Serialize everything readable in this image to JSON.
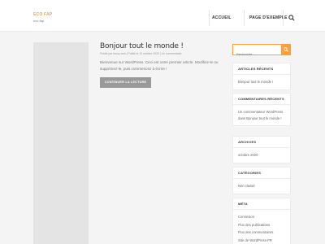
{
  "site": {
    "title": "ECO FAP",
    "tagline": "eco fap"
  },
  "nav": {
    "items": [
      "ACCUEIL",
      "PAGE D'EXEMPLE"
    ]
  },
  "post": {
    "title": "Bonjour tout le monde !",
    "meta": "Publié par lecoq-web | Publié le 13 octobre 2020 | Un commentaire",
    "excerpt": "Bienvenue sur WordPress. Ceci est votre premier article. Modifiez-le ou supprimez-le, puis commencez à écrire !",
    "read_more": "CONTINUER LA LECTURE"
  },
  "search": {
    "placeholder": "Recherche..."
  },
  "widgets": {
    "recent_posts": {
      "title": "ARTICLES RÉCENTS",
      "items": [
        "Bonjour tout le monde !"
      ]
    },
    "recent_comments": {
      "title": "COMMENTAIRES RÉCENTS",
      "items": [
        "Un commentateur WordPress dans Bonjour tout le monde !"
      ]
    },
    "archives": {
      "title": "ARCHIVES",
      "items": [
        "octobre 2020"
      ]
    },
    "categories": {
      "title": "CATÉGORIES",
      "items": [
        "Non classé"
      ]
    },
    "meta": {
      "title": "MÉTA",
      "items": [
        "Connexion",
        "Flux des publications",
        "Flux des commentaires",
        "Site de WordPress-FR"
      ]
    }
  },
  "colors": {
    "accent": "#f9a03f",
    "button": "#999999",
    "background": "#f4f4f4"
  }
}
